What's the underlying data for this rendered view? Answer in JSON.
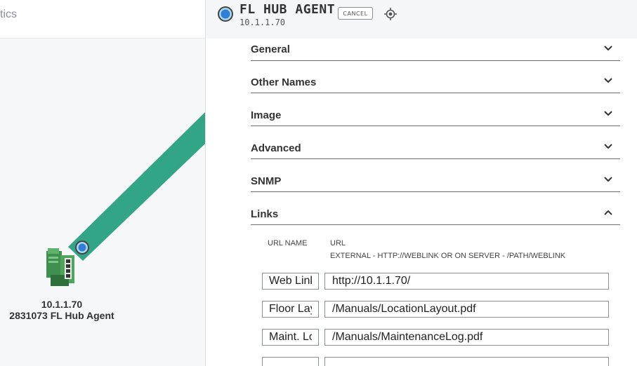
{
  "topbar": {
    "text": "tics"
  },
  "map": {
    "device": {
      "ip": "10.1.1.70",
      "name": "2831073 FL Hub Agent"
    },
    "link_color": "#32a587"
  },
  "panel": {
    "title": "FL HUB AGENT",
    "subtitle": "10.1.1.70",
    "cancel_label": "CANCEL",
    "sections": [
      {
        "label": "General",
        "expanded": false
      },
      {
        "label": "Other Names",
        "expanded": false
      },
      {
        "label": "Image",
        "expanded": false
      },
      {
        "label": "Advanced",
        "expanded": false
      },
      {
        "label": "SNMP",
        "expanded": false
      },
      {
        "label": "Links",
        "expanded": true
      }
    ],
    "links": {
      "col_name": "URL NAME",
      "col_url": "URL",
      "col_note": "EXTERNAL - HTTP://WEBLINK OR ON SERVER - /PATH/WEBLINK",
      "rows": [
        {
          "name": "Web Link",
          "url": "http://10.1.1.70/"
        },
        {
          "name": "Floor Layout",
          "url": "/Manuals/LocationLayout.pdf"
        },
        {
          "name": "Maint. Log",
          "url": "/Manuals/MaintenanceLog.pdf"
        },
        {
          "name": "",
          "url": ""
        }
      ]
    }
  },
  "colors": {
    "accent": "#32a587",
    "node_blue": "#2f7fd6"
  },
  "icons": [
    "node-icon",
    "chevron-down-icon",
    "chevron-up-icon",
    "locate-icon",
    "hub-device-icon"
  ]
}
